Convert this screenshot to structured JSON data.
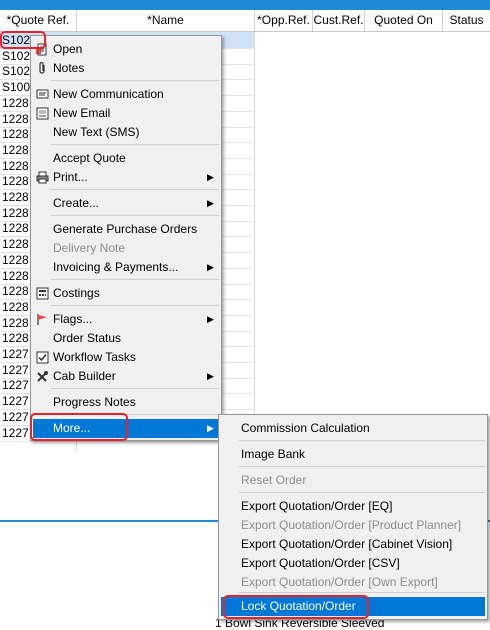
{
  "table": {
    "columns": [
      "*Quote Ref.",
      "*Name",
      "*Opp.Ref.",
      "Cust.Ref.",
      "Quoted On",
      "Status"
    ],
    "rows": [
      "S102",
      "S102",
      "S102",
      "S100",
      "1228",
      "1228",
      "1228",
      "1228",
      "1228",
      "1228",
      "1228",
      "1228",
      "1228",
      "1228",
      "1228",
      "1228",
      "1228",
      "1228",
      "1228",
      "1228",
      "1227",
      "1227",
      "1227",
      "1227",
      "1227",
      "1227"
    ],
    "bottom_text": "1 Bowl Sink Reversible Sleeved"
  },
  "context_menu": {
    "items": [
      {
        "label": "Open",
        "icon": "open-document-icon"
      },
      {
        "label": "Notes",
        "icon": "paperclip-icon"
      },
      {
        "label": "New Communication",
        "icon": "message-icon"
      },
      {
        "label": "New Email",
        "icon": "email-icon"
      },
      {
        "label": "New Text (SMS)"
      },
      {
        "label": "Accept Quote"
      },
      {
        "label": "Print...",
        "icon": "printer-icon",
        "submenu": true
      },
      {
        "label": "Create...",
        "submenu": true
      },
      {
        "label": "Generate Purchase Orders"
      },
      {
        "label": "Delivery Note",
        "disabled": true
      },
      {
        "label": "Invoicing & Payments...",
        "submenu": true
      },
      {
        "label": "Costings",
        "icon": "calculator-icon"
      },
      {
        "label": "Flags...",
        "icon": "flag-icon",
        "submenu": true
      },
      {
        "label": "Order Status"
      },
      {
        "label": "Workflow Tasks",
        "icon": "checkbox-icon"
      },
      {
        "label": "Cab Builder",
        "icon": "tools-icon",
        "submenu": true
      },
      {
        "label": "Progress Notes"
      },
      {
        "label": "More...",
        "submenu": true,
        "highlighted": true
      }
    ]
  },
  "submenu": {
    "items": [
      {
        "label": "Commission Calculation"
      },
      {
        "label": "Image Bank"
      },
      {
        "label": "Reset Order",
        "disabled": true
      },
      {
        "label": "Export Quotation/Order [EQ]"
      },
      {
        "label": "Export Quotation/Order [Product Planner]",
        "disabled": true
      },
      {
        "label": "Export Quotation/Order [Cabinet Vision]"
      },
      {
        "label": "Export Quotation/Order [CSV]"
      },
      {
        "label": "Export Quotation/Order [Own Export]",
        "disabled": true
      },
      {
        "label": "Lock Quotation/Order",
        "highlighted": true
      }
    ]
  },
  "colors": {
    "accent": "#0078d7",
    "title_bar": "#1f8ad8",
    "annotation": "#e8222a",
    "disabled_text": "#8c8c8c"
  }
}
